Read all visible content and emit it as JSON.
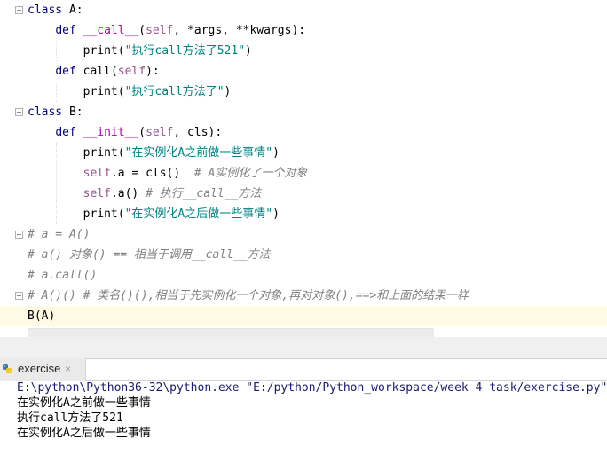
{
  "editor": {
    "lines": [
      {
        "parts": [
          {
            "t": "class ",
            "c": "kw"
          },
          {
            "t": "A",
            "c": ""
          },
          {
            "t": ":",
            "c": ""
          }
        ]
      },
      {
        "parts": [
          {
            "t": "    ",
            "c": ""
          },
          {
            "t": "def ",
            "c": "kw"
          },
          {
            "t": "__call__",
            "c": "fn"
          },
          {
            "t": "(",
            "c": ""
          },
          {
            "t": "self",
            "c": "self"
          },
          {
            "t": ", *args, **kwargs):",
            "c": ""
          }
        ]
      },
      {
        "parts": [
          {
            "t": "        print(",
            "c": ""
          },
          {
            "t": "\"执行call方法了521\"",
            "c": "str"
          },
          {
            "t": ")",
            "c": ""
          }
        ]
      },
      {
        "parts": [
          {
            "t": "    ",
            "c": ""
          },
          {
            "t": "def ",
            "c": "kw"
          },
          {
            "t": "call",
            "c": ""
          },
          {
            "t": "(",
            "c": ""
          },
          {
            "t": "self",
            "c": "self"
          },
          {
            "t": "):",
            "c": ""
          }
        ]
      },
      {
        "parts": [
          {
            "t": "        print(",
            "c": ""
          },
          {
            "t": "\"执行call方法了\"",
            "c": "str"
          },
          {
            "t": ")",
            "c": ""
          }
        ]
      },
      {
        "parts": [
          {
            "t": "class ",
            "c": "kw"
          },
          {
            "t": "B",
            "c": ""
          },
          {
            "t": ":",
            "c": ""
          }
        ]
      },
      {
        "parts": [
          {
            "t": "    ",
            "c": ""
          },
          {
            "t": "def ",
            "c": "kw"
          },
          {
            "t": "__init__",
            "c": "fn"
          },
          {
            "t": "(",
            "c": ""
          },
          {
            "t": "self",
            "c": "self"
          },
          {
            "t": ", cls):",
            "c": ""
          }
        ]
      },
      {
        "parts": [
          {
            "t": "        print(",
            "c": ""
          },
          {
            "t": "\"在实例化A之前做一些事情\"",
            "c": "str"
          },
          {
            "t": ")",
            "c": ""
          }
        ]
      },
      {
        "parts": [
          {
            "t": "        ",
            "c": ""
          },
          {
            "t": "self",
            "c": "self"
          },
          {
            "t": ".a = cls()  ",
            "c": ""
          },
          {
            "t": "# A实例化了一个对象",
            "c": "cmt"
          }
        ]
      },
      {
        "parts": [
          {
            "t": "        ",
            "c": ""
          },
          {
            "t": "self",
            "c": "self"
          },
          {
            "t": ".a() ",
            "c": ""
          },
          {
            "t": "# 执行__call__方法",
            "c": "cmt"
          }
        ]
      },
      {
        "parts": [
          {
            "t": "        print(",
            "c": ""
          },
          {
            "t": "\"在实例化A之后做一些事情\"",
            "c": "str"
          },
          {
            "t": ")",
            "c": ""
          }
        ]
      },
      {
        "parts": [
          {
            "t": "# a = A()",
            "c": "cmt"
          }
        ]
      },
      {
        "parts": [
          {
            "t": "# a() 对象() == 相当于调用__call__方法",
            "c": "cmt"
          }
        ]
      },
      {
        "parts": [
          {
            "t": "# a.call()",
            "c": "cmt"
          }
        ]
      },
      {
        "parts": [
          {
            "t": "# A()() # 类名()(),相当于先实例化一个对象,再对对象(),==>和上面的结果一样",
            "c": "cmt"
          }
        ]
      },
      {
        "parts": [
          {
            "t": "B(A)",
            "c": ""
          }
        ]
      }
    ]
  },
  "run": {
    "tab_label": "exercise",
    "tab_close": "×",
    "output": [
      "E:\\python\\Python36-32\\python.exe \"E:/python/Python_workspace/week 4 task/exercise.py\"",
      "在实例化A之前做一些事情",
      "执行call方法了521",
      "在实例化A之后做一些事情"
    ]
  },
  "icons": {
    "fold": "fold-marker-icon",
    "python": "python-file-icon"
  },
  "colors": {
    "keyword": "#000080",
    "string": "#008080",
    "self": "#94558d",
    "comment": "#808080",
    "current_line": "#fffae3"
  }
}
